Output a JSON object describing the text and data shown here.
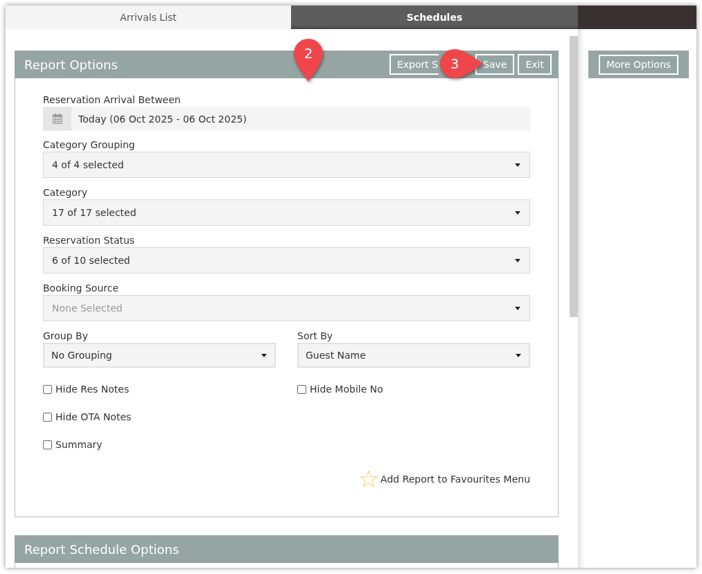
{
  "tabs": [
    {
      "label": "Arrivals List",
      "selected": true
    },
    {
      "label": "Schedules",
      "selected": false
    }
  ],
  "report_options": {
    "title": "Report Options",
    "buttons": [
      "Export S",
      "Save",
      "Exit"
    ],
    "fields": [
      {
        "kind": "date",
        "label": "Reservation Arrival Between",
        "value": "Today (06 Oct 2025 - 06 Oct 2025)"
      },
      {
        "kind": "select",
        "label": "Category Grouping",
        "value": "4 of 4 selected"
      },
      {
        "kind": "select",
        "label": "Category",
        "value": "17 of 17 selected"
      },
      {
        "kind": "select",
        "label": "Reservation Status",
        "value": "6 of 10 selected"
      },
      {
        "kind": "select",
        "label": "Booking Source",
        "placeholder": "None Selected"
      }
    ],
    "paired_fields": [
      {
        "label": "Group By",
        "value": "No Grouping"
      },
      {
        "label": "Sort By",
        "value": "Guest Name"
      }
    ],
    "checkbox_rows": [
      [
        {
          "label": "Hide Res Notes",
          "checked": false
        },
        {
          "label": "Hide Mobile No",
          "checked": false
        }
      ],
      [
        {
          "label": "Hide OTA Notes",
          "checked": false
        }
      ],
      [
        {
          "label": "Summary",
          "checked": false
        }
      ]
    ],
    "favourite": {
      "label": "Add Report to Favourites Menu",
      "starred": false
    }
  },
  "schedule_options": {
    "title": "Report Schedule Options"
  },
  "side_panel": {
    "button": "More Options"
  },
  "annotations": [
    {
      "label": "2",
      "kind": "pin"
    },
    {
      "label": "3",
      "kind": "callout"
    }
  ]
}
